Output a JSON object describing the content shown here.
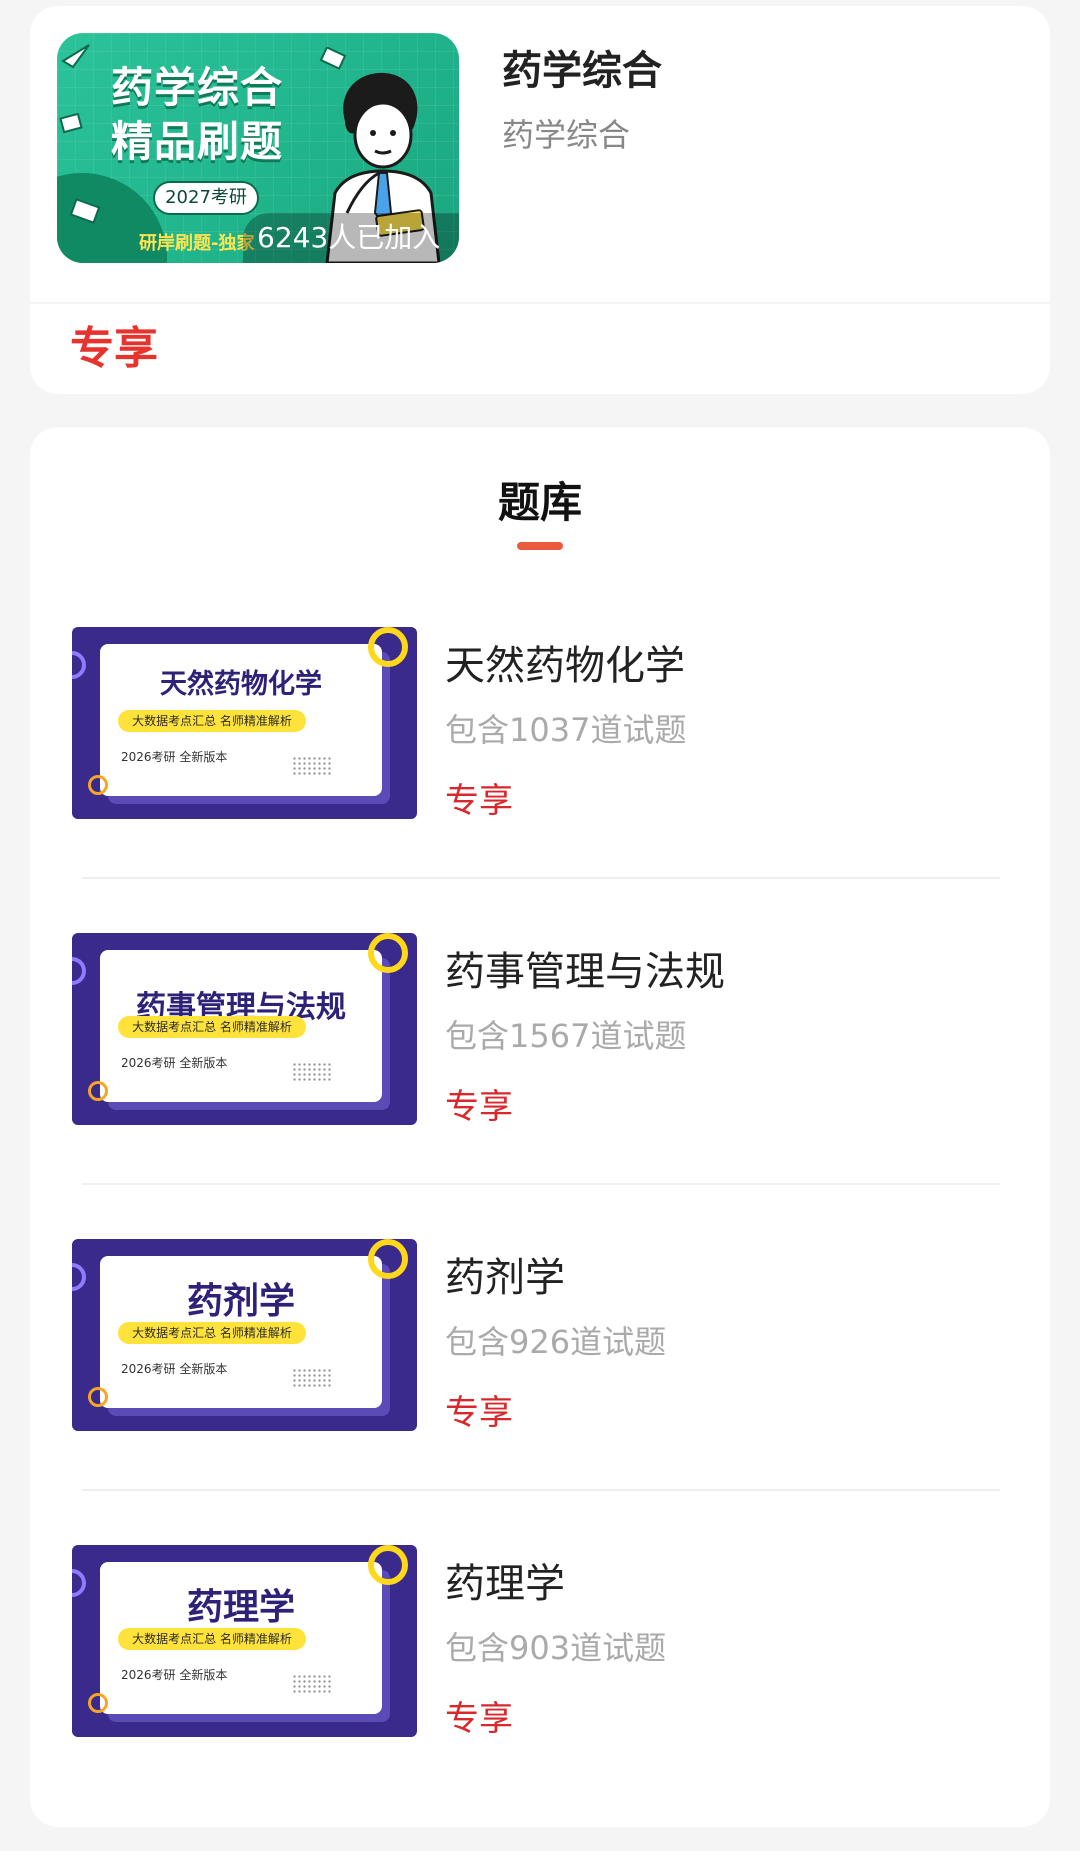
{
  "course": {
    "cover": {
      "title_line1": "药学综合",
      "title_line2": "精品刷题",
      "badge": "2027考研",
      "subtitle": "研岸刷题-独家",
      "joined": "6243人已加入"
    },
    "title": "药学综合",
    "subtitle": "药学综合",
    "tag": "专享"
  },
  "bank": {
    "heading": "题库",
    "items": [
      {
        "cover_title": "天然药物化学",
        "cover_banner": "大数据考点汇总 名师精准解析",
        "cover_edition": "2026考研 全新版本",
        "title": "天然药物化学",
        "count": "包含1037道试题",
        "tag": "专享"
      },
      {
        "cover_title": "药事管理与法规",
        "cover_banner": "大数据考点汇总 名师精准解析",
        "cover_edition": "2026考研 全新版本",
        "title": "药事管理与法规",
        "count": "包含1567道试题",
        "tag": "专享"
      },
      {
        "cover_title": "药剂学",
        "cover_banner": "大数据考点汇总 名师精准解析",
        "cover_edition": "2026考研 全新版本",
        "title": "药剂学",
        "count": "包含926道试题",
        "tag": "专享"
      },
      {
        "cover_title": "药理学",
        "cover_banner": "大数据考点汇总 名师精准解析",
        "cover_edition": "2026考研 全新版本",
        "title": "药理学",
        "count": "包含903道试题",
        "tag": "专享"
      }
    ]
  },
  "colors": {
    "accent_red": "#e8322d",
    "cover_green": "#21b58c",
    "cover_purple": "#3a2a8c",
    "heading_bar": "#ec5a3d"
  }
}
